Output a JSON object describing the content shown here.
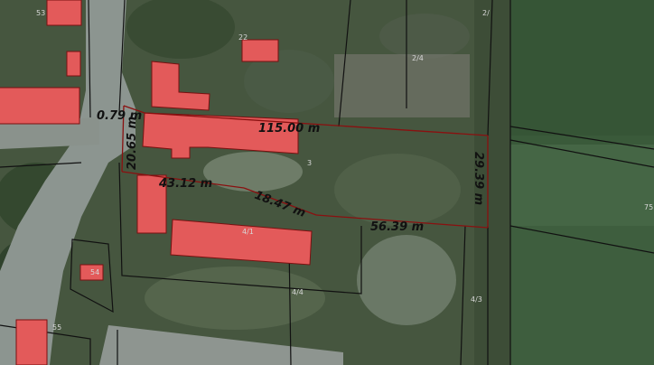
{
  "map": {
    "colors": {
      "building_fill": "#e35a5a",
      "building_stroke": "#7a1010",
      "boundary": "#111111",
      "measure_line": "#8a1010",
      "road": "#8e9590",
      "field": "#3a5a3a",
      "vegetation": "#3f5b38"
    },
    "measurements": [
      {
        "id": "a",
        "text": "0.79 m"
      },
      {
        "id": "b",
        "text": "115.00 m"
      },
      {
        "id": "c",
        "text": "20.65 m"
      },
      {
        "id": "d",
        "text": "43.12 m"
      },
      {
        "id": "e",
        "text": "18.47 m"
      },
      {
        "id": "f",
        "text": "56.39 m"
      },
      {
        "id": "g",
        "text": "29.39 m"
      }
    ],
    "plot_numbers": {
      "p53": "53",
      "p22": "22",
      "p24": "2/4",
      "p2": "2/",
      "p3": "3",
      "p41": "4/1",
      "p44": "4/4",
      "p43": "4/3",
      "p54": "54",
      "p55": "55",
      "p75": "75"
    }
  }
}
